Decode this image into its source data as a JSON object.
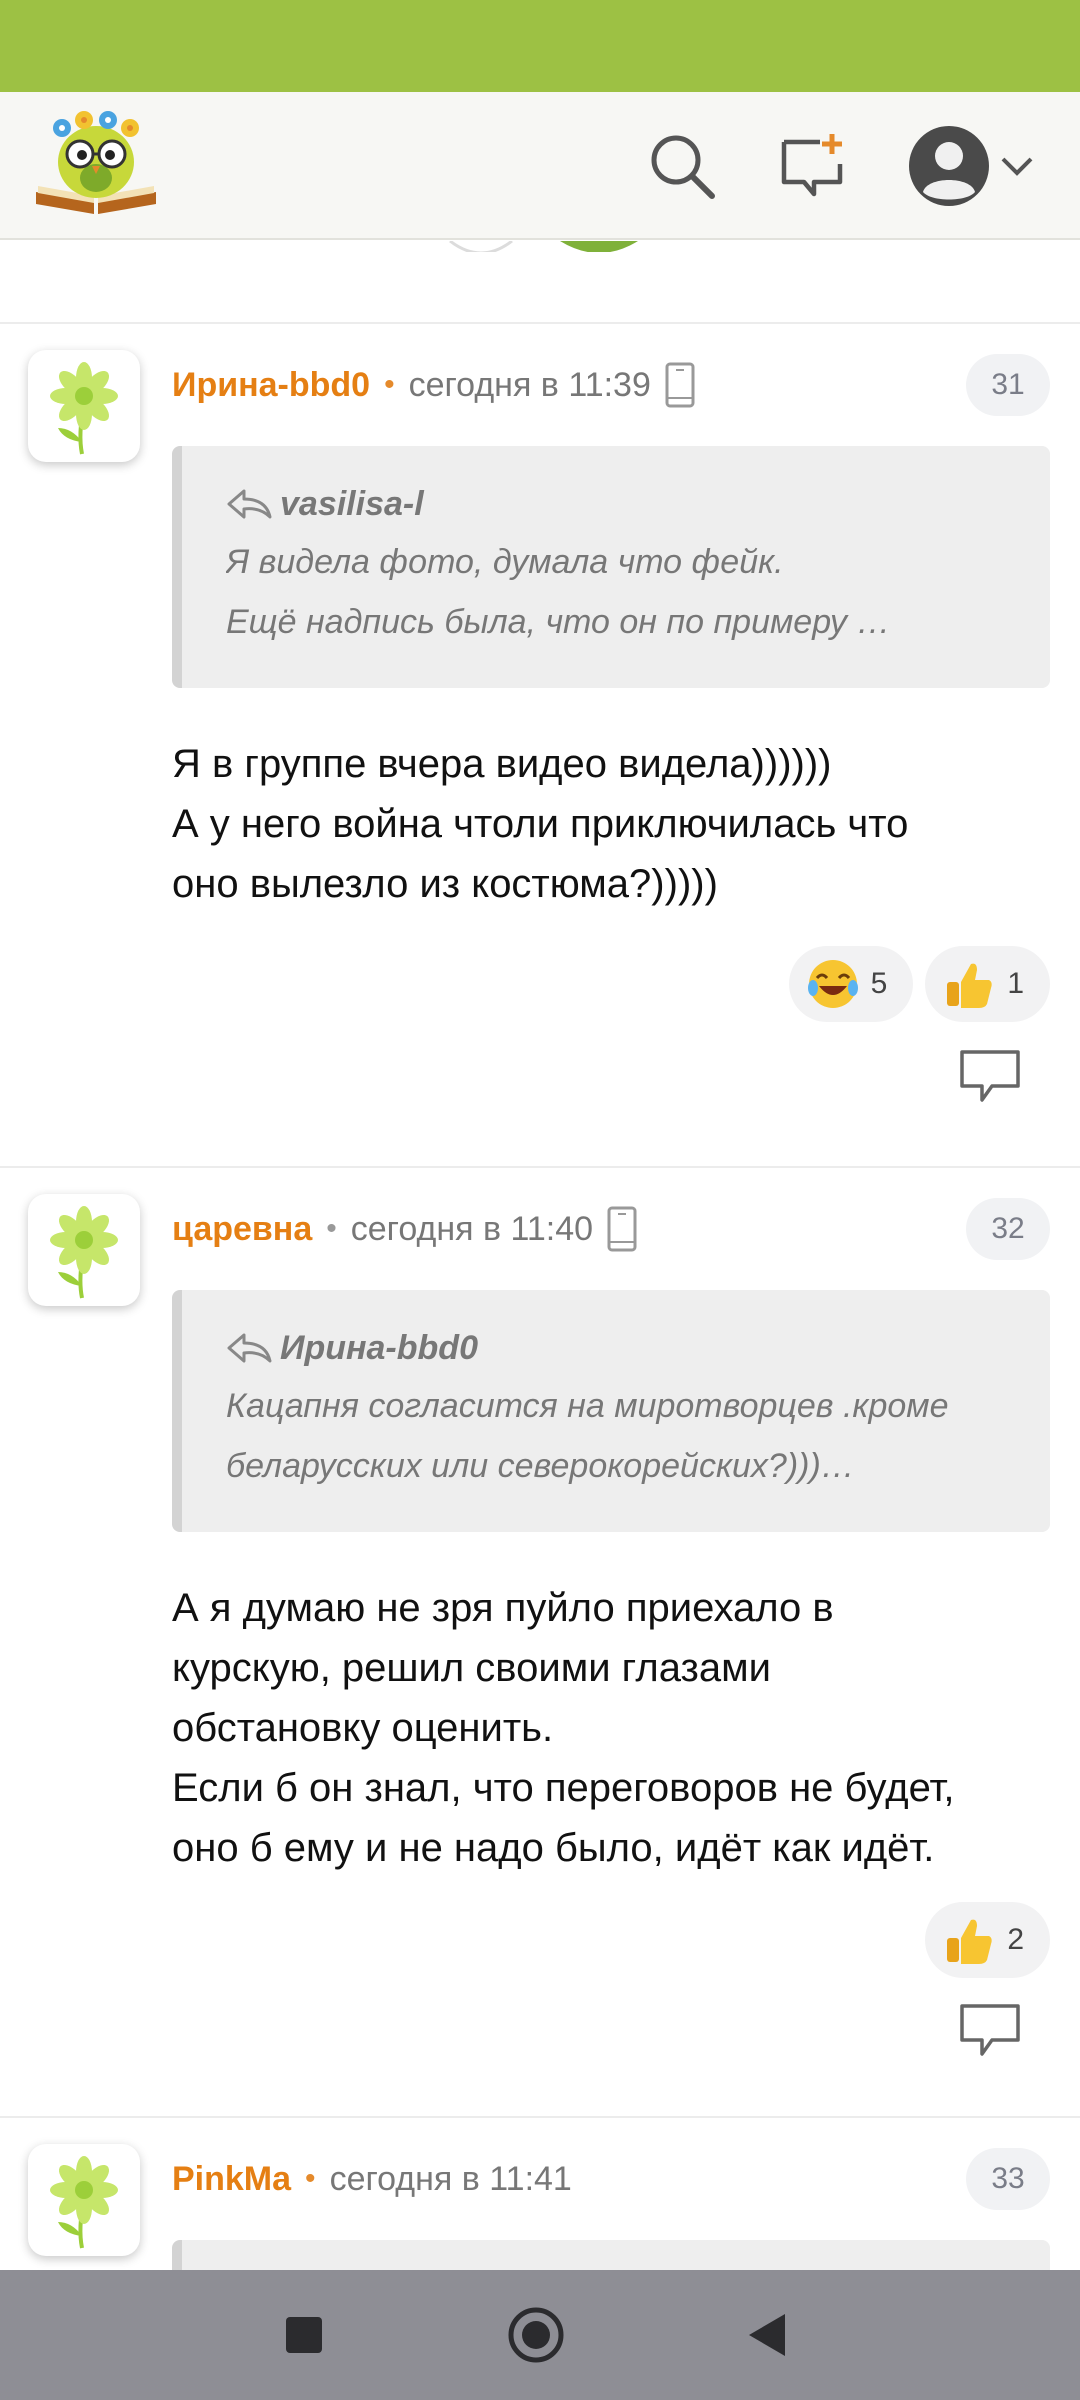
{
  "colors": {
    "status_bar": "#9dc144",
    "accent": "#e57f13",
    "meta_text": "#777777",
    "quote_bg": "#eeeeee",
    "nav_bar": "#8e8e95"
  },
  "header": {
    "icons": [
      "owl-logo",
      "search-icon",
      "new-post-icon",
      "profile-icon",
      "chevron-down-icon"
    ]
  },
  "comments": [
    {
      "author": "Ирина-bbd0",
      "time": "сегодня в 11:39",
      "number": "31",
      "quote": {
        "author": "vasilisa-l",
        "lines": [
          "Я видела фото, думала что фейк.",
          "Ещё  надпись  была,  что  он  по  примеру  …"
        ]
      },
      "text": [
        "Я в группе вчера видео видела))))))",
        "А у него война чтоли приключилась что",
        "оно вылезло из костюма?)))))"
      ],
      "reactions": [
        {
          "icon": "laughing-emoji",
          "count": "5"
        },
        {
          "icon": "thumbs-up-emoji",
          "count": "1"
        }
      ]
    },
    {
      "author": "царевна",
      "time": "сегодня в 11:40",
      "number": "32",
      "quote": {
        "author": "Ирина-bbd0",
        "lines": [
          "Кацапня  согласится  на  миротворцев  .кроме",
          "беларусских или северокорейских?)))…"
        ]
      },
      "text": [
        "А я думаю не зря пуйло приехало в",
        "курскую, решил своими глазами",
        "обстановку оценить.",
        "Если б он знал, что переговоров не будет,",
        "оно б ему и не надо было, идёт как идёт."
      ],
      "reactions": [
        {
          "icon": "thumbs-up-emoji",
          "count": "2"
        }
      ]
    },
    {
      "author": "PinkMa",
      "time": "сегодня в 11:41",
      "number": "33"
    }
  ],
  "nav": {
    "icons": [
      "recents-square-icon",
      "home-circle-icon",
      "back-triangle-icon"
    ]
  }
}
